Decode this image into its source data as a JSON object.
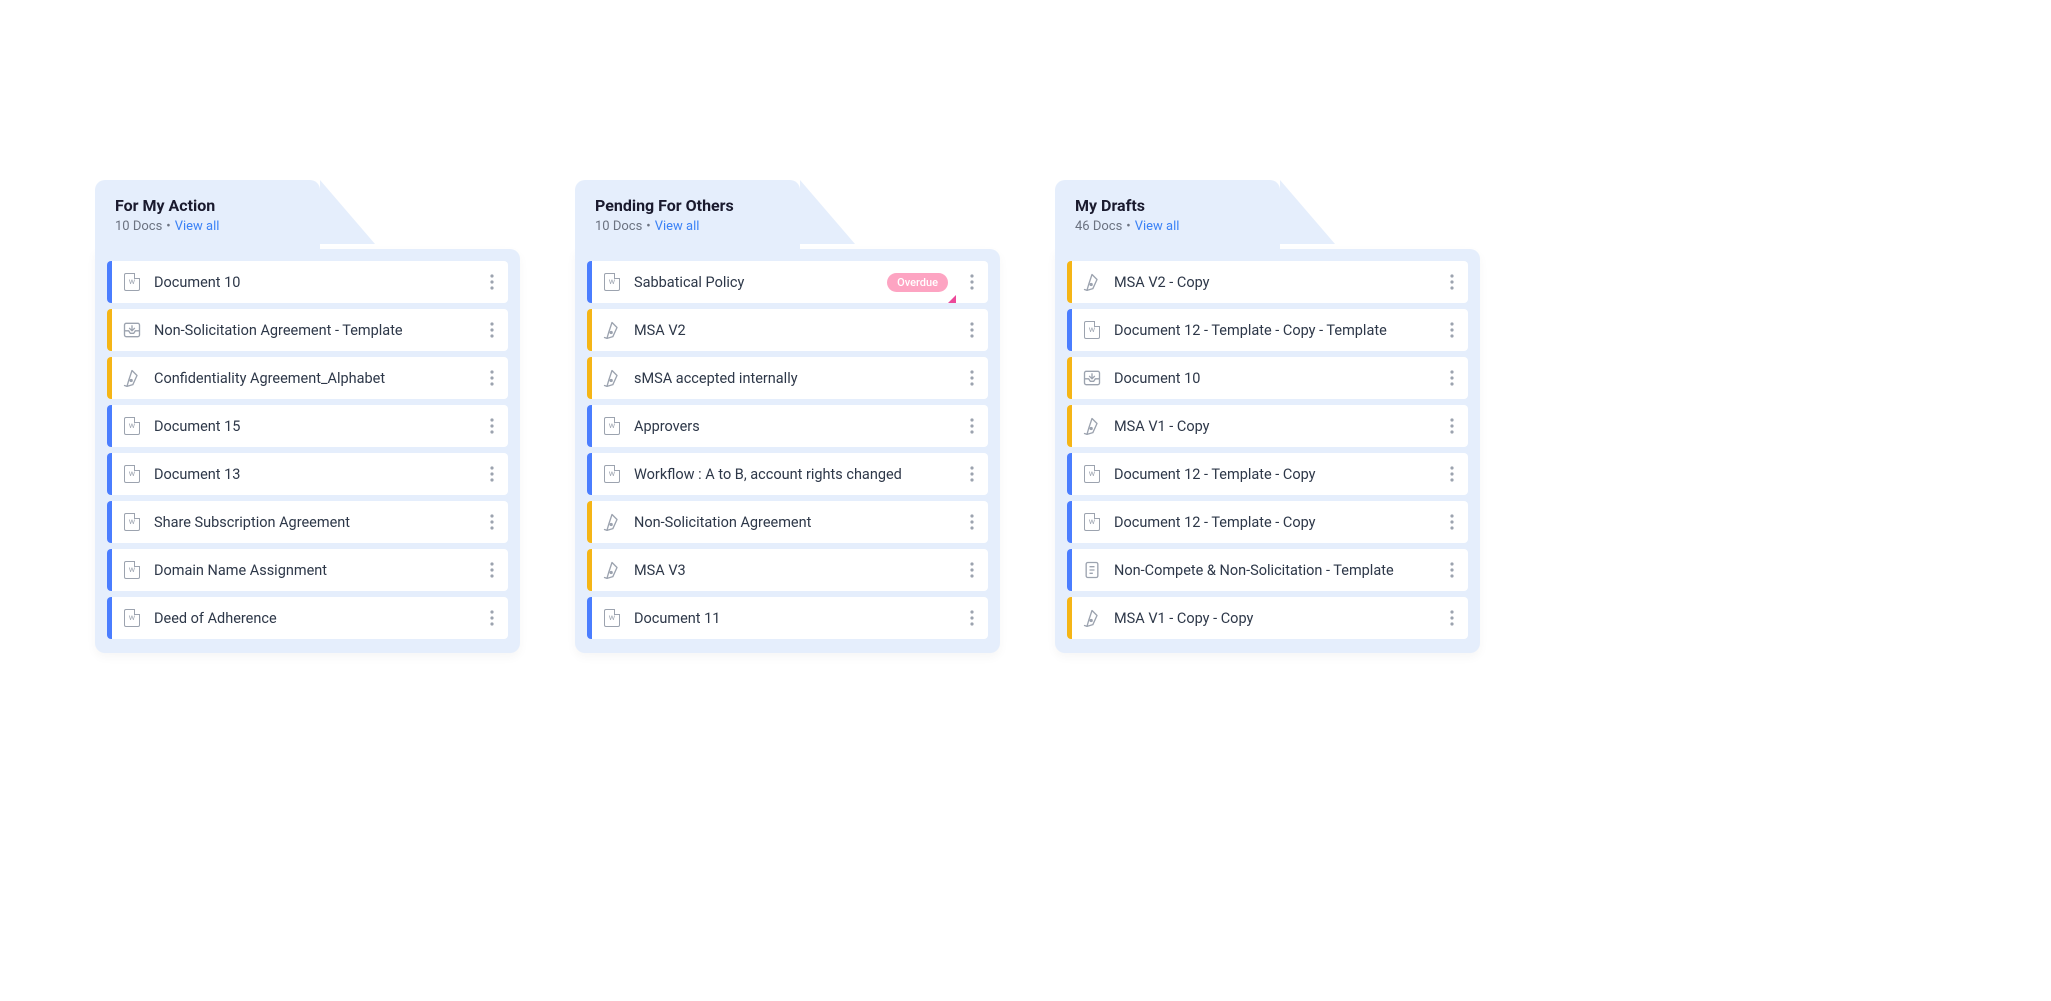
{
  "columns": [
    {
      "title": "For My Action",
      "docs_count": "10 Docs",
      "view_all": "View all",
      "items": [
        {
          "stripe": "blue",
          "icon": "word",
          "title": "Document 10"
        },
        {
          "stripe": "yellow",
          "icon": "tray",
          "title": "Non-Solicitation Agreement - Template"
        },
        {
          "stripe": "yellow",
          "icon": "pen",
          "title": "Confidentiality Agreement_Alphabet"
        },
        {
          "stripe": "blue",
          "icon": "word",
          "title": "Document 15"
        },
        {
          "stripe": "blue",
          "icon": "word",
          "title": "Document 13"
        },
        {
          "stripe": "blue",
          "icon": "word",
          "title": "Share Subscription Agreement"
        },
        {
          "stripe": "blue",
          "icon": "word",
          "title": "Domain Name Assignment"
        },
        {
          "stripe": "blue",
          "icon": "word",
          "title": "Deed of Adherence"
        }
      ]
    },
    {
      "title": "Pending For Others",
      "docs_count": "10 Docs",
      "view_all": "View all",
      "items": [
        {
          "stripe": "blue",
          "icon": "word",
          "title": "Sabbatical Policy",
          "badge": "Overdue",
          "corner": true
        },
        {
          "stripe": "yellow",
          "icon": "pen",
          "title": "MSA V2"
        },
        {
          "stripe": "yellow",
          "icon": "pen",
          "title": "sMSA accepted internally"
        },
        {
          "stripe": "blue",
          "icon": "word",
          "title": "Approvers"
        },
        {
          "stripe": "blue",
          "icon": "word",
          "title": "Workflow : A to B, account rights changed"
        },
        {
          "stripe": "yellow",
          "icon": "pen",
          "title": "Non-Solicitation Agreement"
        },
        {
          "stripe": "yellow",
          "icon": "pen",
          "title": "MSA V3"
        },
        {
          "stripe": "blue",
          "icon": "word",
          "title": "Document 11"
        }
      ]
    },
    {
      "title": "My Drafts",
      "docs_count": "46 Docs",
      "view_all": "View all",
      "items": [
        {
          "stripe": "yellow",
          "icon": "pen",
          "title": "MSA V2 - Copy"
        },
        {
          "stripe": "blue",
          "icon": "word",
          "title": "Document 12 - Template - Copy - Template"
        },
        {
          "stripe": "yellow",
          "icon": "tray",
          "title": "Document 10"
        },
        {
          "stripe": "yellow",
          "icon": "pen",
          "title": "MSA V1 - Copy"
        },
        {
          "stripe": "blue",
          "icon": "word",
          "title": "Document 12 - Template - Copy"
        },
        {
          "stripe": "blue",
          "icon": "word",
          "title": "Document 12 - Template - Copy"
        },
        {
          "stripe": "blue",
          "icon": "doc",
          "title": "Non-Compete & Non-Solicitation - Template"
        },
        {
          "stripe": "yellow",
          "icon": "pen",
          "title": "MSA V1 - Copy - Copy"
        }
      ]
    }
  ]
}
